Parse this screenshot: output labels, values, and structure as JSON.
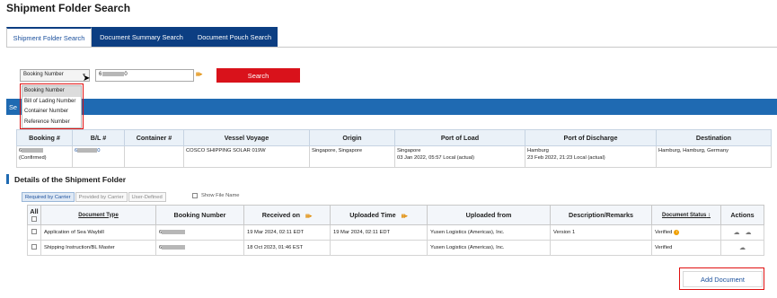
{
  "page_title": "Shipment Folder Search",
  "tabs": [
    "Shipment Folder Search",
    "Document Summary Search",
    "Document Pouch Search"
  ],
  "search": {
    "type_selected": "Booking Number",
    "input_value_prefix": "6",
    "input_value_suffix": "0",
    "button_label": "Search"
  },
  "dropdown_options": [
    "Booking Number",
    "Bill of Lading Number",
    "Container Number",
    "Reference Number"
  ],
  "results_bar_label": "Se",
  "shipment_table": {
    "headers": [
      "Booking #",
      "B/L #",
      "Container #",
      "Vessel Voyage",
      "Origin",
      "Port of Load",
      "Port of Discharge",
      "Destination"
    ],
    "row": {
      "booking_prefix": "6",
      "booking_status": "(Confirmed)",
      "bl_prefix": "6",
      "bl_suffix": "0",
      "container": "",
      "vessel_voyage": "COSCO SHIPPING SOLAR 019W",
      "origin": "Singapore, Singapore",
      "port_of_load": "Singapore",
      "port_of_load_date": "03 Jan 2022, 05:57 Local (actual)",
      "port_of_discharge": "Hamburg",
      "port_of_discharge_date": "23 Feb 2022, 21:23 Local (actual)",
      "destination": "Hamburg, Hamburg, Germany"
    }
  },
  "details": {
    "title": "Details of the Shipment Folder",
    "subtabs": [
      "Required by Carrier",
      "Provided by Carrier",
      "User-Defined"
    ],
    "show_file_name": "Show File Name"
  },
  "doc_table": {
    "headers": [
      "All",
      "Document Type",
      "Booking Number",
      "Received on",
      "Uploaded Time",
      "Uploaded from",
      "Description/Remarks",
      "Document Status",
      "Actions"
    ],
    "rows": [
      {
        "doc_type": "Application of Sea Waybill",
        "booking_prefix": "6",
        "received_on": "19 Mar 2024, 02:11 EDT",
        "uploaded_time": "19 Mar 2024, 02:11 EDT",
        "uploaded_from": "Yusen Logistics (Americas), Inc.",
        "description": "Version 1",
        "status": "Verified"
      },
      {
        "doc_type": "Shipping Instruction/BL Master",
        "booking_prefix": "6",
        "received_on": "18 Oct 2023, 01:46 EST",
        "uploaded_time": "",
        "uploaded_from": "Yusen Logistics (Americas), Inc.",
        "description": "",
        "status": "Verified"
      }
    ]
  },
  "add_document_label": "Add Document",
  "icons": {
    "file_icon": "file-icon-tiny",
    "sort_icon": "sort-icon",
    "download_icon": "download-icon",
    "upload_icon": "upload-icon",
    "warning_icon": "warning-icon"
  },
  "colors": {
    "tab_blue": "#0c3e82",
    "accent_blue": "#1f6ab2",
    "search_red": "#d9121b",
    "highlight_red": "#e01010"
  }
}
